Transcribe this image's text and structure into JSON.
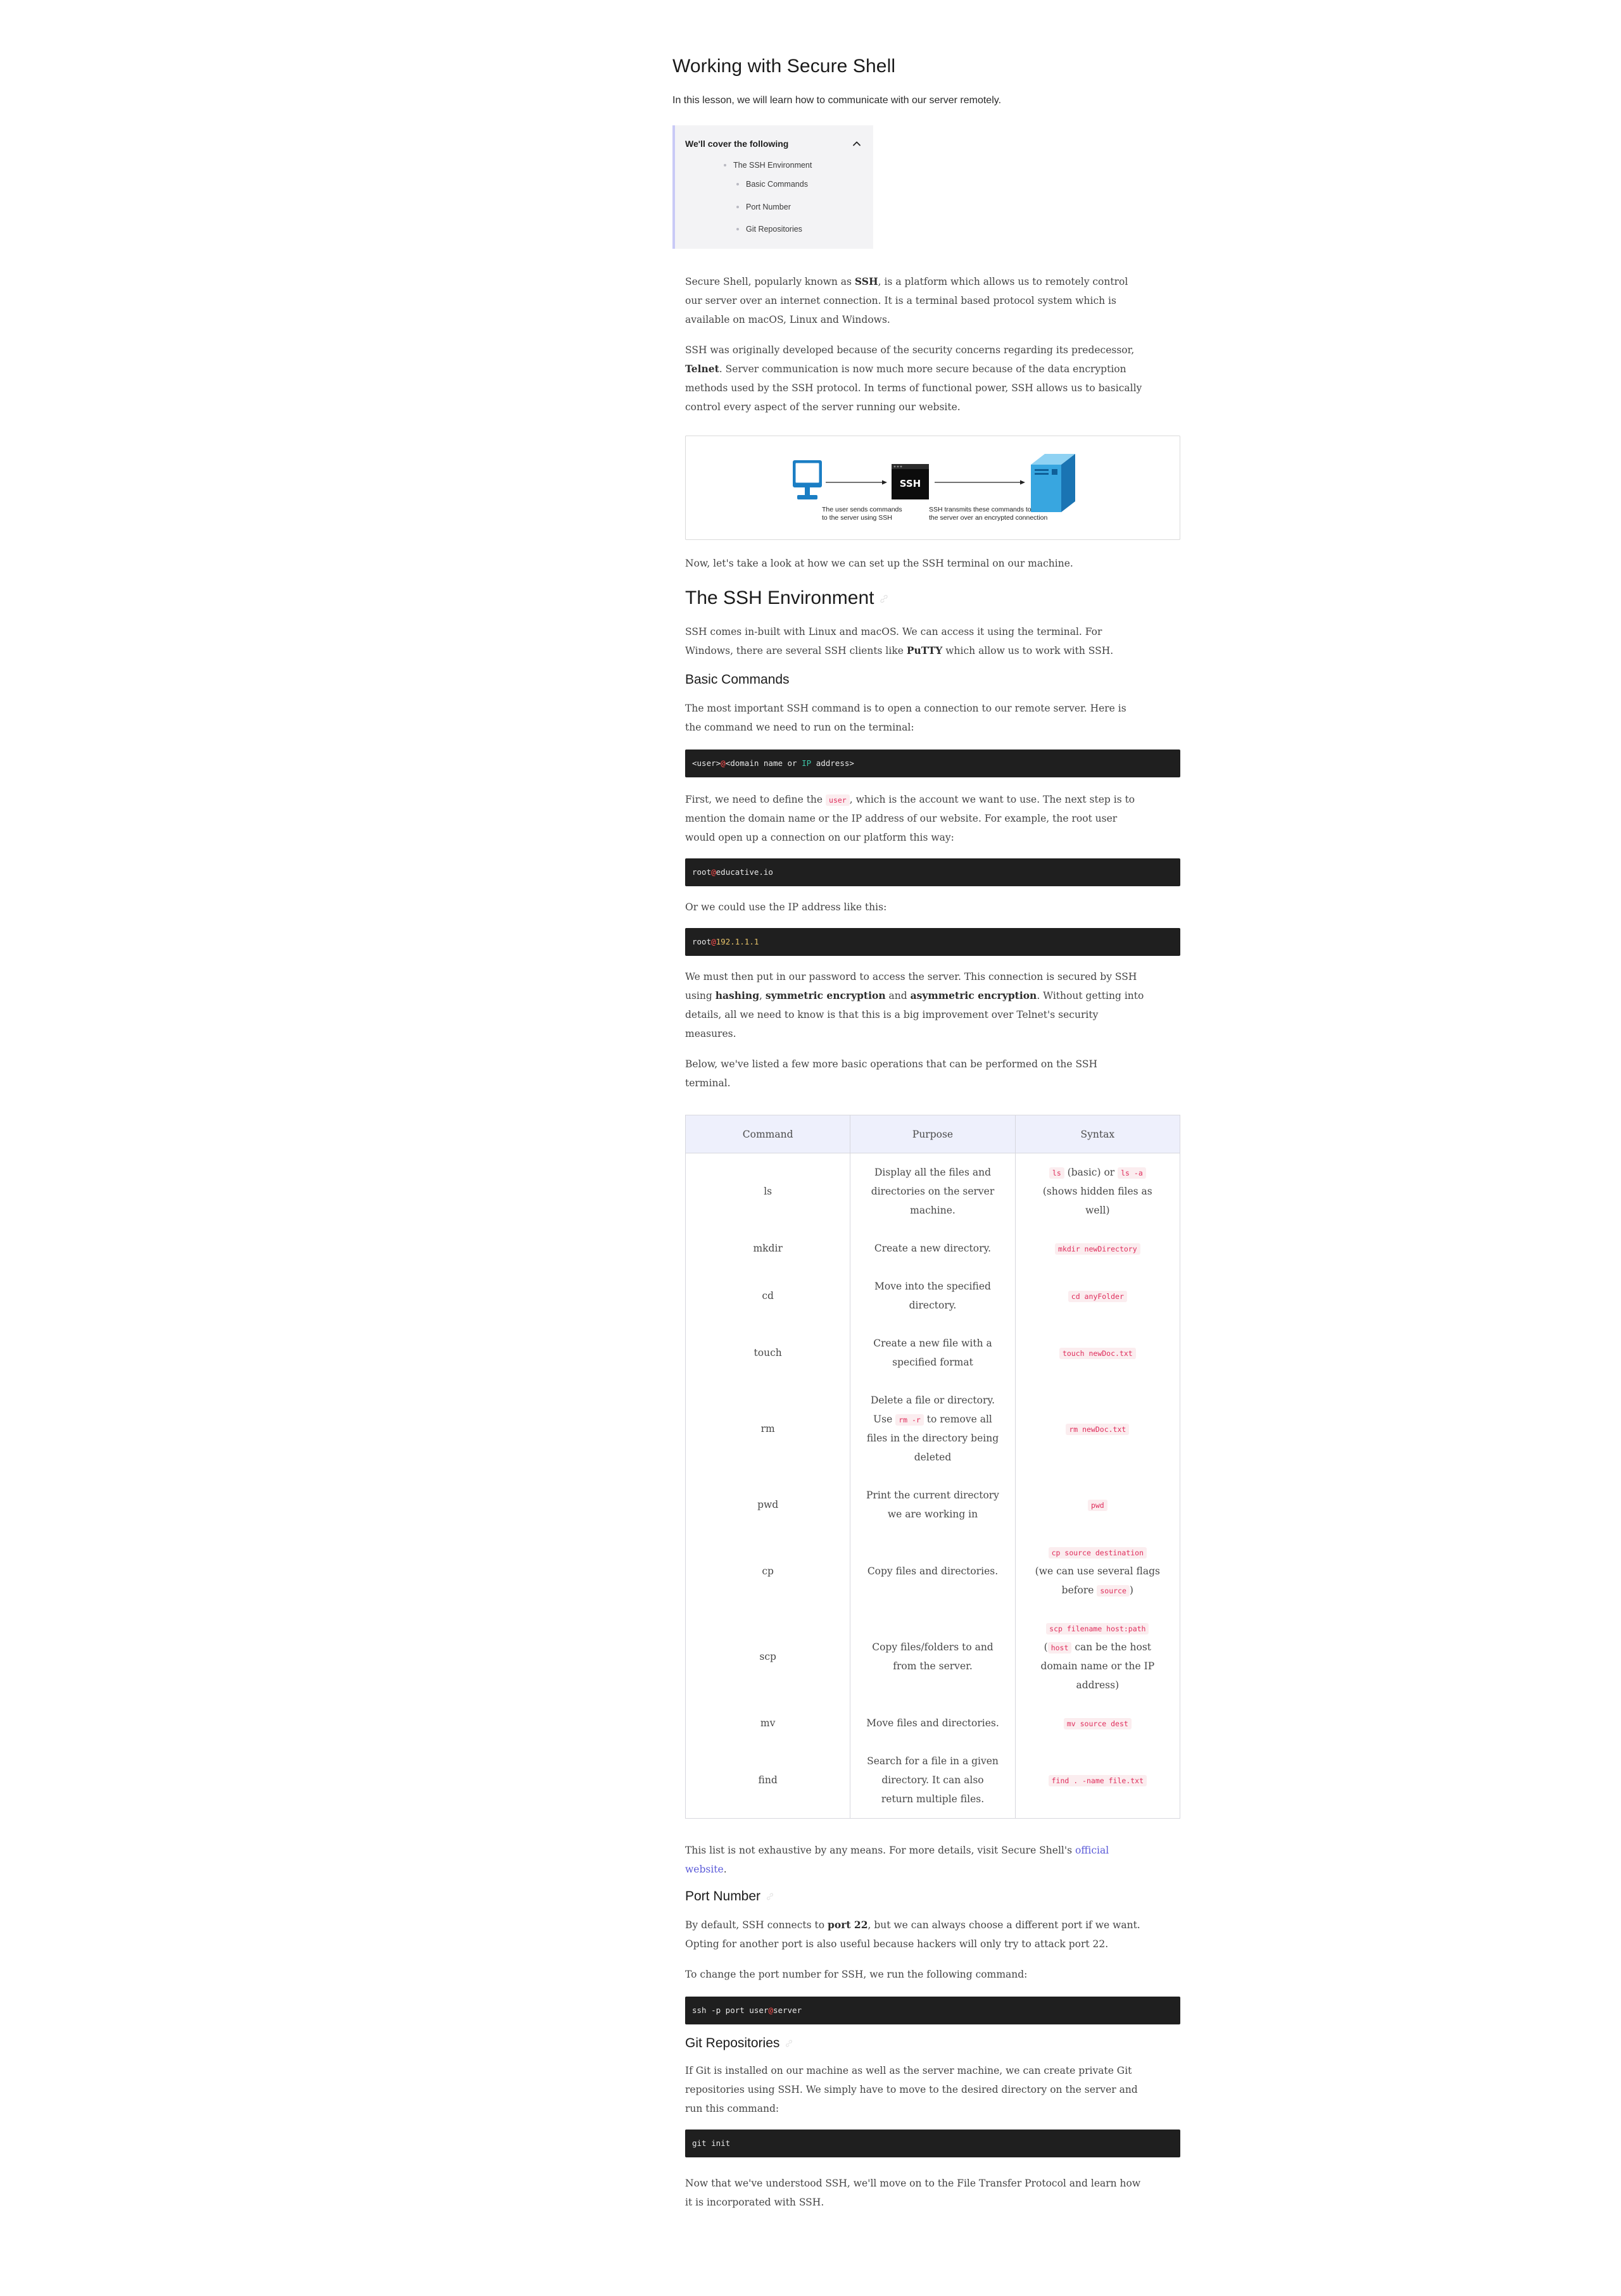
{
  "colors": {
    "body_text": "#444444",
    "heading_text": "#1b1b1b",
    "toc_accent": "#c9caf6",
    "toc_background": "#f3f3f5",
    "link": "#5a5ad8",
    "inline_code_text": "#df2c5b",
    "inline_code_background": "#fbedef",
    "code_block_background": "#1f1f1f",
    "table_header_background": "#eef0fc"
  },
  "page": {
    "title": "Working with Secure Shell",
    "intro": "In this lesson, we will learn how to communicate with our server remotely."
  },
  "toc": {
    "heading": "We'll cover the following",
    "toggle_icon": "chevron-up-icon",
    "items": [
      {
        "label": "The SSH Environment",
        "level": 1
      },
      {
        "label": "Basic Commands",
        "level": 2
      },
      {
        "label": "Port Number",
        "level": 2
      },
      {
        "label": "Git Repositories",
        "level": 2
      }
    ]
  },
  "figure": {
    "source_icon": "monitor-icon",
    "box_label": "SSH",
    "target_icon": "server-icon",
    "caption_left": [
      "The user sends commands",
      "to the server using SSH"
    ],
    "caption_right": [
      "SSH transmits these commands to",
      "the server over an encrypted connection"
    ]
  },
  "headings": {
    "ssh_environment": "The SSH Environment",
    "basic_commands": "Basic Commands",
    "port_number": "Port Number",
    "git_repositories": "Git Repositories",
    "anchor_icon": "link-icon"
  },
  "content": {
    "p1": [
      [
        "Secure Shell, popularly known as ",
        {
          "text": "SSH",
          "style": "bold"
        },
        ", is a platform which allows us to remotely control"
      ],
      [
        "our server over an internet connection. It is a terminal based protocol system which is"
      ],
      [
        "available on macOS, Linux and Windows."
      ]
    ],
    "p2": [
      [
        "SSH was originally developed because of the security concerns regarding its predecessor,"
      ],
      [
        {
          "text": "Telnet",
          "style": "bold"
        },
        ". Server communication is now much more secure because of the data encryption"
      ],
      [
        "methods used by the SSH protocol. In terms of functional power, SSH allows us to basically"
      ],
      [
        "control every aspect of the server running our website."
      ]
    ],
    "p3": [
      [
        "Now, let's take a look at how we can set up the SSH terminal on our machine."
      ]
    ],
    "p4": [
      [
        "SSH comes in-built with Linux and macOS. We can access it using the terminal. For"
      ],
      [
        "Windows, there are several SSH clients like ",
        {
          "text": "PuTTY",
          "style": "bold"
        },
        " which allow us to work with SSH."
      ]
    ],
    "p5": [
      [
        "The most important SSH command is to open a connection to our remote server. Here is"
      ],
      [
        "the command we need to run on the terminal:"
      ]
    ],
    "code1": [
      [
        "<user>",
        {
          "text": "@",
          "style": "at"
        },
        "<domain name or ",
        {
          "text": "IP",
          "style": "keyword"
        },
        " address>"
      ]
    ],
    "p6": [
      [
        "First, we need to define the ",
        {
          "text": "user",
          "style": "code"
        },
        ", which is the account we want to use. The next step is to"
      ],
      [
        "mention the domain name or the IP address of our website. For example, the root user"
      ],
      [
        "would open up a connection on our platform this way:"
      ]
    ],
    "code2": [
      [
        "root",
        {
          "text": "@",
          "style": "at"
        },
        "educative.io"
      ]
    ],
    "p7": [
      [
        "Or we could use the IP address like this:"
      ]
    ],
    "code3": [
      [
        "root",
        {
          "text": "@",
          "style": "at"
        },
        {
          "text": "192.1.1.1",
          "style": "number"
        }
      ]
    ],
    "p8": [
      [
        "We must then put in our password to access the server. This connection is secured by SSH"
      ],
      [
        "using ",
        {
          "text": "hashing",
          "style": "bold"
        },
        ", ",
        {
          "text": "symmetric encryption",
          "style": "bold"
        },
        " and ",
        {
          "text": "asymmetric encryption",
          "style": "bold"
        },
        ". Without getting into"
      ],
      [
        "details, all we need to know is that this is a big improvement over Telnet's security"
      ],
      [
        "measures."
      ]
    ],
    "p9": [
      [
        "Below, we've listed a few more basic operations that can be performed on the SSH"
      ],
      [
        "terminal."
      ]
    ],
    "p10": [
      [
        "This list is not exhaustive by any means. For more details, visit Secure Shell's ",
        {
          "text": "official",
          "style": "link"
        }
      ],
      [
        {
          "text": "website",
          "style": "link"
        },
        "."
      ]
    ],
    "p11": [
      [
        "By default, SSH connects to ",
        {
          "text": "port 22",
          "style": "bold"
        },
        ", but we can always choose a different port if we want."
      ],
      [
        "Opting for another port is also useful because hackers will only try to attack port 22."
      ]
    ],
    "p12": [
      [
        "To change the port number for SSH, we run the following command:"
      ]
    ],
    "code4": [
      [
        "ssh -p port user",
        {
          "text": "@",
          "style": "at"
        },
        "server"
      ]
    ],
    "p13": [
      [
        "If Git is installed on our machine as well as the server machine, we can create private Git"
      ],
      [
        "repositories using SSH. We simply have to move to the desired directory on the server and"
      ],
      [
        "run this command:"
      ]
    ],
    "code5": [
      [
        "git init"
      ]
    ],
    "p14": [
      [
        "Now that we've understood SSH, we'll move on to the File Transfer Protocol and learn how"
      ],
      [
        "it is incorporated with SSH."
      ]
    ]
  },
  "table": {
    "headers": [
      "Command",
      "Purpose",
      "Syntax"
    ],
    "rows": [
      {
        "command": "ls",
        "purpose": [
          [
            "Display all the files and"
          ],
          [
            "directories on the server"
          ],
          [
            "machine."
          ]
        ],
        "syntax": [
          [
            {
              "text": "ls",
              "style": "code"
            },
            " (basic) or ",
            {
              "text": "ls -a",
              "style": "code"
            }
          ],
          [
            "(shows hidden files as"
          ],
          [
            "well)"
          ]
        ]
      },
      {
        "command": "mkdir",
        "purpose": [
          [
            "Create a new directory."
          ]
        ],
        "syntax": [
          [
            {
              "text": "mkdir newDirectory",
              "style": "code"
            }
          ]
        ]
      },
      {
        "command": "cd",
        "purpose": [
          [
            "Move into the specified"
          ],
          [
            "directory."
          ]
        ],
        "syntax": [
          [
            {
              "text": "cd anyFolder",
              "style": "code"
            }
          ]
        ]
      },
      {
        "command": "touch",
        "purpose": [
          [
            "Create a new file with a"
          ],
          [
            "specified format"
          ]
        ],
        "syntax": [
          [
            {
              "text": "touch newDoc.txt",
              "style": "code"
            }
          ]
        ]
      },
      {
        "command": "rm",
        "purpose": [
          [
            "Delete a file or directory."
          ],
          [
            "Use ",
            {
              "text": "rm -r",
              "style": "code"
            },
            " to remove all"
          ],
          [
            "files in the directory being"
          ],
          [
            "deleted"
          ]
        ],
        "syntax": [
          [
            {
              "text": "rm newDoc.txt",
              "style": "code"
            }
          ]
        ]
      },
      {
        "command": "pwd",
        "purpose": [
          [
            "Print the current directory"
          ],
          [
            "we are working in"
          ]
        ],
        "syntax": [
          [
            {
              "text": "pwd",
              "style": "code"
            }
          ]
        ]
      },
      {
        "command": "cp",
        "purpose": [
          [
            "Copy files and directories."
          ]
        ],
        "syntax": [
          [
            {
              "text": "cp source destination",
              "style": "code"
            }
          ],
          [
            "(we can use several flags"
          ],
          [
            "before ",
            {
              "text": "source",
              "style": "code"
            },
            ")"
          ]
        ]
      },
      {
        "command": "scp",
        "purpose": [
          [
            "Copy files/folders to and"
          ],
          [
            "from the server."
          ]
        ],
        "syntax": [
          [
            {
              "text": "scp filename host:path",
              "style": "code"
            }
          ],
          [
            "(",
            {
              "text": "host",
              "style": "code"
            },
            " can be the host"
          ],
          [
            "domain name or the IP"
          ],
          [
            "address)"
          ]
        ]
      },
      {
        "command": "mv",
        "purpose": [
          [
            "Move files and directories."
          ]
        ],
        "syntax": [
          [
            {
              "text": "mv source dest",
              "style": "code"
            }
          ]
        ]
      },
      {
        "command": "find",
        "purpose": [
          [
            "Search for a file in a given"
          ],
          [
            "directory. It can also"
          ],
          [
            "return multiple files."
          ]
        ],
        "syntax": [
          [
            {
              "text": "find . -name file.txt",
              "style": "code"
            }
          ]
        ]
      }
    ]
  }
}
